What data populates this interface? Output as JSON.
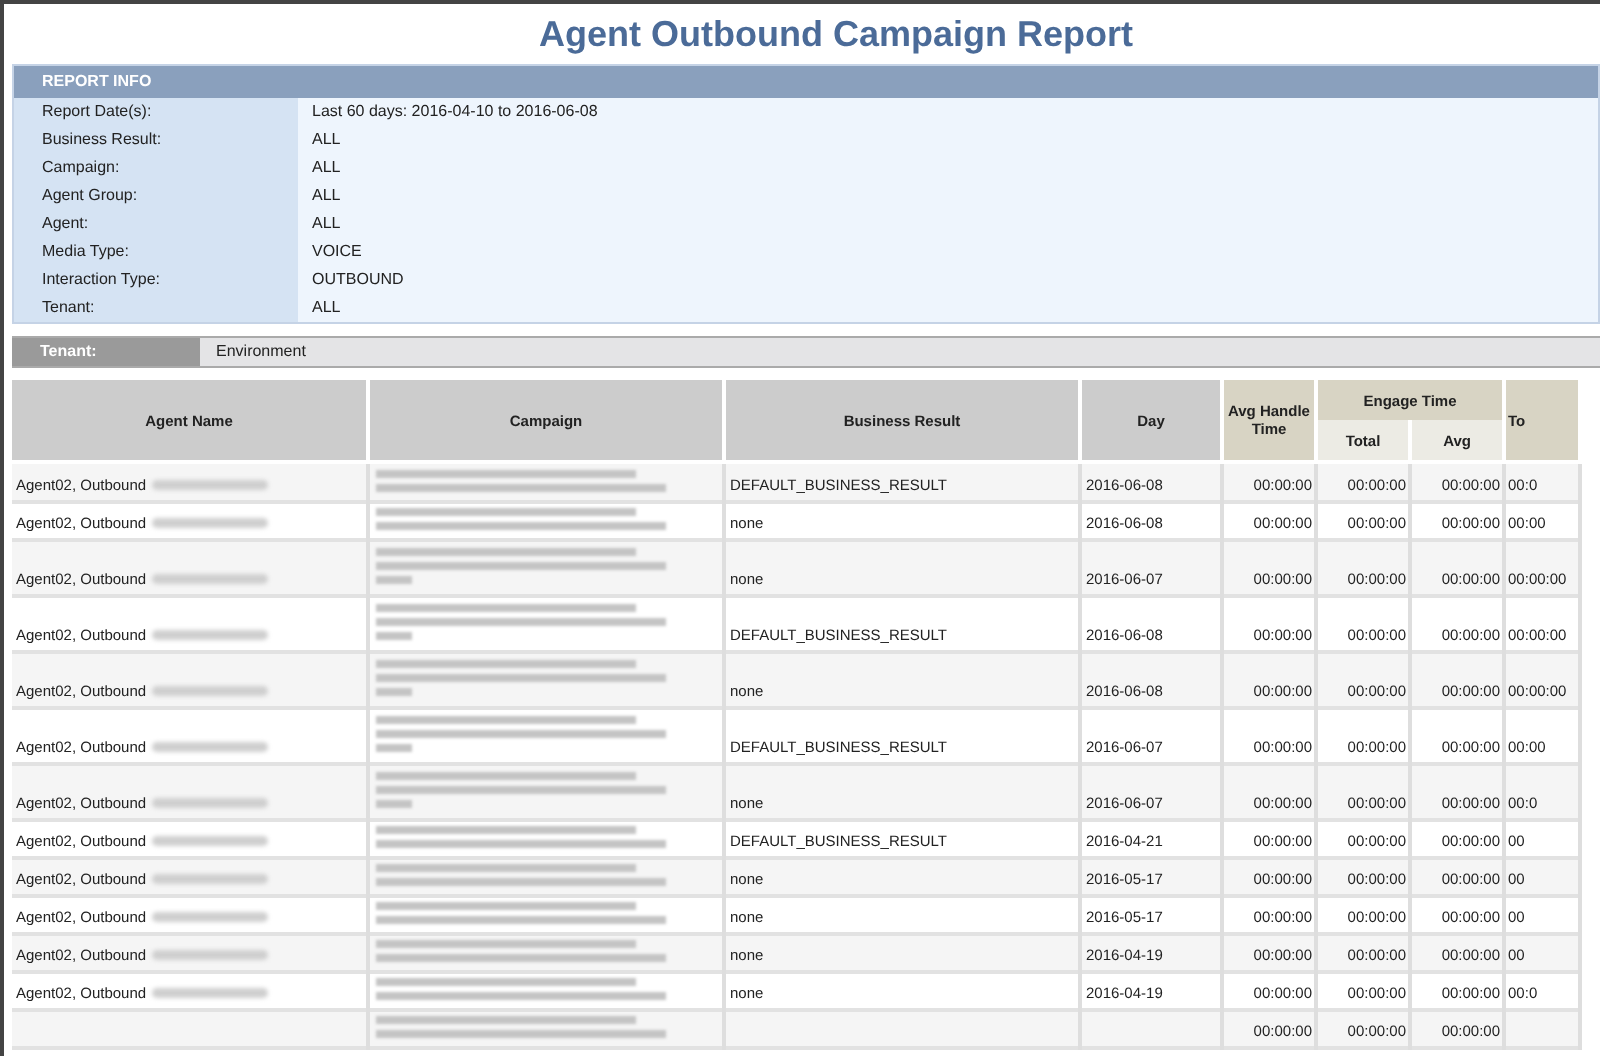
{
  "title": "Agent Outbound Campaign Report",
  "report_info": {
    "heading": "REPORT INFO",
    "fields": [
      {
        "label": "Report Date(s):",
        "value": "Last 60 days: 2016-04-10 to 2016-06-08"
      },
      {
        "label": "Business Result:",
        "value": "ALL"
      },
      {
        "label": "Campaign:",
        "value": "ALL"
      },
      {
        "label": "Agent Group:",
        "value": "ALL"
      },
      {
        "label": "Agent:",
        "value": "ALL"
      },
      {
        "label": "Media Type:",
        "value": "VOICE"
      },
      {
        "label": "Interaction Type:",
        "value": "OUTBOUND"
      },
      {
        "label": "Tenant:",
        "value": "ALL"
      }
    ]
  },
  "tenant_bar": {
    "label": "Tenant:",
    "value": "Environment"
  },
  "table": {
    "columns": [
      {
        "label": "Agent Name"
      },
      {
        "label": "Campaign"
      },
      {
        "label": "Business Result"
      },
      {
        "label": "Day"
      },
      {
        "label": "Avg Handle Time"
      }
    ],
    "group_column": {
      "label": "Engage Time",
      "subcolumns": [
        "Total",
        "Avg"
      ]
    },
    "column_8": "To",
    "rows": [
      {
        "agent": "Agent02, Outbound",
        "kind": "short",
        "result": "DEFAULT_BUSINESS_RESULT",
        "day": "2016-06-08",
        "avg_handle": "00:00:00",
        "total": "00:00:00",
        "avg": "00:00:00",
        "column_8": "00:0"
      },
      {
        "agent": "Agent02, Outbound",
        "kind": "short",
        "result": "none",
        "day": "2016-06-08",
        "avg_handle": "00:00:00",
        "total": "00:00:00",
        "avg": "00:00:00",
        "column_8": "00:00"
      },
      {
        "agent": "Agent02, Outbound",
        "kind": "tall",
        "result": "none",
        "day": "2016-06-07",
        "avg_handle": "00:00:00",
        "total": "00:00:00",
        "avg": "00:00:00",
        "column_8": "00:00:00"
      },
      {
        "agent": "Agent02, Outbound",
        "kind": "tall",
        "result": "DEFAULT_BUSINESS_RESULT",
        "day": "2016-06-08",
        "avg_handle": "00:00:00",
        "total": "00:00:00",
        "avg": "00:00:00",
        "column_8": "00:00:00"
      },
      {
        "agent": "Agent02, Outbound",
        "kind": "tall",
        "result": "none",
        "day": "2016-06-08",
        "avg_handle": "00:00:00",
        "total": "00:00:00",
        "avg": "00:00:00",
        "column_8": "00:00:00"
      },
      {
        "agent": "Agent02, Outbound",
        "kind": "tall",
        "result": "DEFAULT_BUSINESS_RESULT",
        "day": "2016-06-07",
        "avg_handle": "00:00:00",
        "total": "00:00:00",
        "avg": "00:00:00",
        "column_8": "00:00"
      },
      {
        "agent": "Agent02, Outbound",
        "kind": "tall",
        "result": "none",
        "day": "2016-06-07",
        "avg_handle": "00:00:00",
        "total": "00:00:00",
        "avg": "00:00:00",
        "column_8": "00:0"
      },
      {
        "agent": "Agent02, Outbound",
        "kind": "short",
        "result": "DEFAULT_BUSINESS_RESULT",
        "day": "2016-04-21",
        "avg_handle": "00:00:00",
        "total": "00:00:00",
        "avg": "00:00:00",
        "column_8": "00"
      },
      {
        "agent": "Agent02, Outbound",
        "kind": "short",
        "result": "none",
        "day": "2016-05-17",
        "avg_handle": "00:00:00",
        "total": "00:00:00",
        "avg": "00:00:00",
        "column_8": "00"
      },
      {
        "agent": "Agent02, Outbound",
        "kind": "short",
        "result": "none",
        "day": "2016-05-17",
        "avg_handle": "00:00:00",
        "total": "00:00:00",
        "avg": "00:00:00",
        "column_8": "00"
      },
      {
        "agent": "Agent02, Outbound",
        "kind": "short",
        "result": "none",
        "day": "2016-04-19",
        "avg_handle": "00:00:00",
        "total": "00:00:00",
        "avg": "00:00:00",
        "column_8": "00"
      },
      {
        "agent": "Agent02, Outbound",
        "kind": "short",
        "result": "none",
        "day": "2016-04-19",
        "avg_handle": "00:00:00",
        "total": "00:00:00",
        "avg": "00:00:00",
        "column_8": "00:0"
      },
      {
        "agent": "",
        "kind": "short",
        "result": "",
        "day": "",
        "avg_handle": "00:00:00",
        "total": "00:00:00",
        "avg": "00:00:00",
        "column_8": ""
      }
    ]
  }
}
